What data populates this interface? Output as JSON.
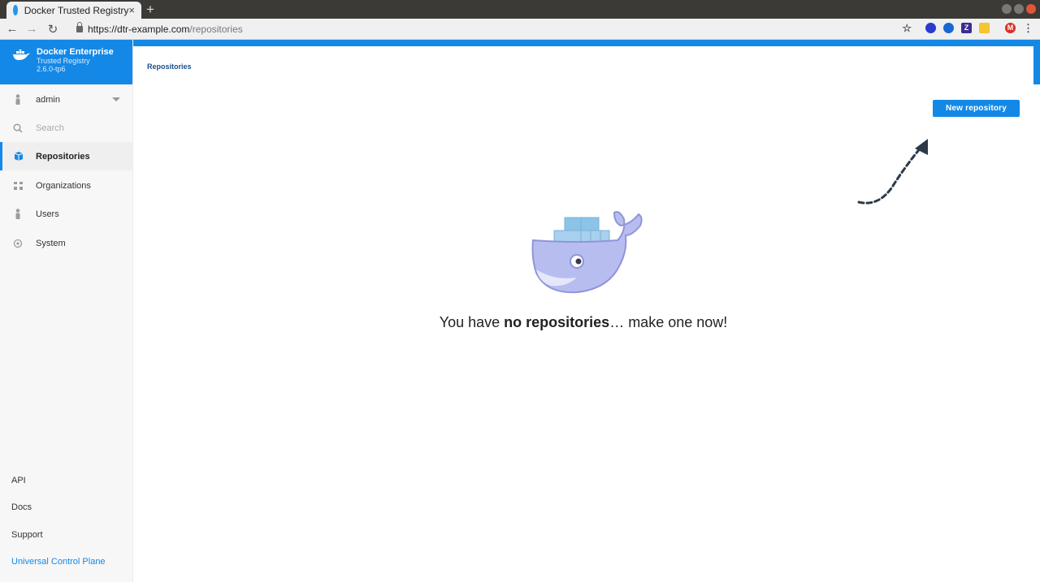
{
  "browser": {
    "tab_title": "Docker Trusted Registry",
    "tab_close": "×",
    "new_tab": "+",
    "url_host": "https://dtr-example.com",
    "url_path": "/repositories",
    "ext_letters": {
      "z": "Z",
      "m": "M"
    }
  },
  "brand": {
    "title": "Docker Enterprise",
    "subtitle": "Trusted Registry",
    "version": "2.6.0-tp6"
  },
  "sidebar": {
    "user": "admin",
    "search_placeholder": "Search",
    "items": [
      {
        "label": "Repositories",
        "icon": "repositories-icon",
        "active": true
      },
      {
        "label": "Organizations",
        "icon": "organizations-icon"
      },
      {
        "label": "Users",
        "icon": "user-icon"
      },
      {
        "label": "System",
        "icon": "gear-icon"
      }
    ],
    "footer": [
      {
        "label": "API"
      },
      {
        "label": "Docs"
      },
      {
        "label": "Support"
      },
      {
        "label": "Universal Control Plane"
      }
    ]
  },
  "main": {
    "breadcrumb": "Repositories",
    "new_repo_label": "New repository",
    "empty_pre": "You have ",
    "empty_bold": "no repositories",
    "empty_post": "… make one now!"
  },
  "colors": {
    "accent": "#1488e6",
    "whale": "#9aa0e0",
    "container": "#8cc4e8"
  }
}
